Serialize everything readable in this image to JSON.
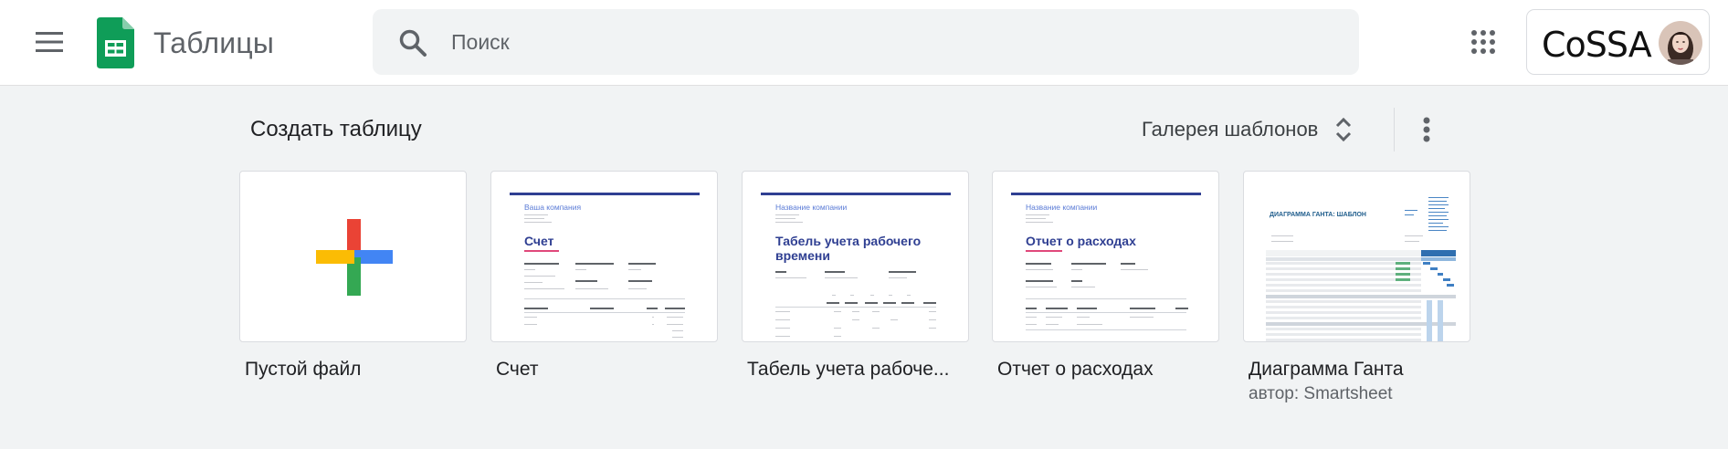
{
  "header": {
    "app_title": "Таблицы",
    "search": {
      "placeholder": "Поиск",
      "value": ""
    },
    "account": {
      "brand": "CoSSA"
    }
  },
  "icons": {
    "menu": "hamburger-menu-icon",
    "logo": "sheets-logo-icon",
    "search": "search-icon",
    "apps": "apps-grid-icon",
    "expand": "unfold-icon",
    "more": "more-vert-icon"
  },
  "colors": {
    "sheets_green": "#0f9d58",
    "google_red": "#ea4335",
    "google_blue": "#4285f4",
    "google_yellow": "#fbbc04",
    "google_green": "#34a853",
    "template_accent": "#2f3f92"
  },
  "templates": {
    "section_title": "Создать таблицу",
    "gallery_label": "Галерея шаблонов",
    "items": [
      {
        "name": "Пустой файл"
      },
      {
        "name": "Счет",
        "preview": {
          "company": "Ваша компания",
          "heading": "Счет"
        }
      },
      {
        "name": "Табель учета рабоче...",
        "preview": {
          "company": "Название компании",
          "heading_l1": "Табель учета рабочего",
          "heading_l2": "времени"
        }
      },
      {
        "name": "Отчет о расходах",
        "preview": {
          "company": "Название компании",
          "heading": "Отчет о расходах"
        }
      },
      {
        "name": "Диаграмма Ганта",
        "author": "автор: Smartsheet",
        "preview": {
          "heading": "ДИАГРАММА ГАНТА: ШАБЛОН"
        }
      }
    ]
  }
}
